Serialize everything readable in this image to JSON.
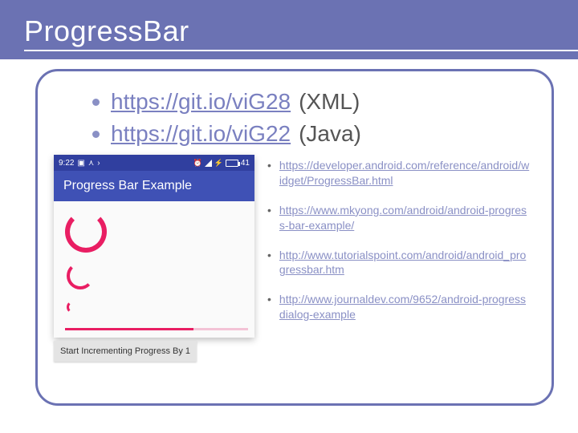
{
  "header": {
    "title": "ProgressBar"
  },
  "main_links": [
    {
      "url": "https://git.io/viG28",
      "suffix": "(XML)"
    },
    {
      "url": "https://git.io/viG22",
      "suffix": "(Java)"
    }
  ],
  "phone": {
    "status_time": "9:22",
    "battery_pct": "41",
    "appbar_title": "Progress Bar Example",
    "button_label": "Start Incrementing Progress By 1"
  },
  "ref_links": [
    "https://developer.android.com/reference/android/widget/ProgressBar.html",
    "https://www.mkyong.com/android/android-progress-bar-example/",
    "http://www.tutorialspoint.com/android/android_progressbar.htm",
    "http://www.journaldev.com/9652/android-progressdialog-example"
  ]
}
